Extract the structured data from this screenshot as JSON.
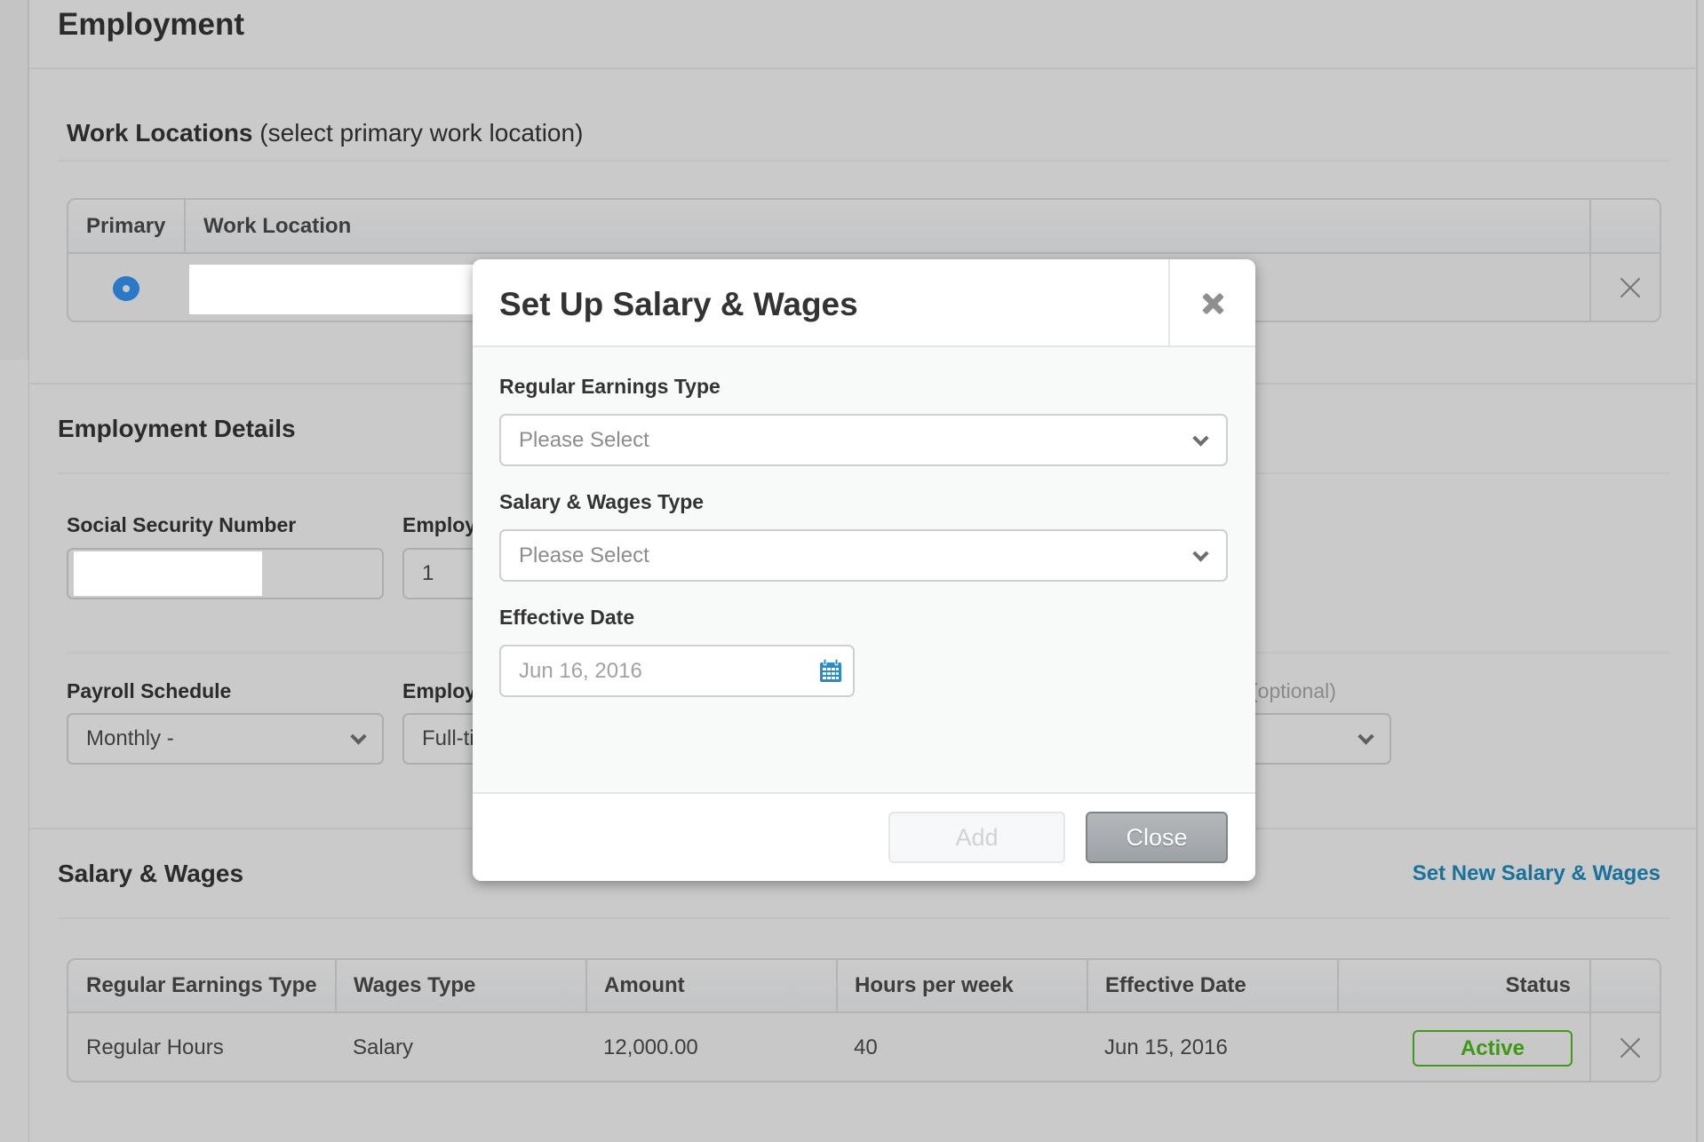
{
  "page": {
    "title": "Employment"
  },
  "work_locations": {
    "heading": "Work Locations",
    "subheading": "(select primary work location)",
    "columns": [
      "Primary",
      "Work Location"
    ],
    "rows": [
      {
        "primary": true,
        "location": ""
      }
    ]
  },
  "employment_details": {
    "heading": "Employment Details",
    "fields": {
      "ssn": {
        "label": "Social Security Number",
        "value": ""
      },
      "employee_id": {
        "label": "Employ",
        "value": "1"
      },
      "payroll_schedule": {
        "label": "Payroll Schedule",
        "value": "Monthly -"
      },
      "employment_type": {
        "label": "Employ",
        "value": "Full-ti"
      },
      "optional_field": {
        "label": "(optional)",
        "value": ""
      }
    }
  },
  "salary_wages": {
    "heading": "Salary & Wages",
    "set_new_link": "Set New Salary & Wages",
    "columns": [
      "Regular Earnings Type",
      "Wages Type",
      "Amount",
      "Hours per week",
      "Effective Date",
      "Status"
    ],
    "rows": [
      {
        "earnings_type": "Regular Hours",
        "wages_type": "Salary",
        "amount": "12,000.00",
        "hours_per_week": "40",
        "effective_date": "Jun 15, 2016",
        "status": "Active"
      }
    ]
  },
  "modal": {
    "title": "Set Up Salary & Wages",
    "regular_earnings_type": {
      "label": "Regular Earnings Type",
      "placeholder": "Please Select"
    },
    "salary_wages_type": {
      "label": "Salary & Wages Type",
      "placeholder": "Please Select"
    },
    "effective_date": {
      "label": "Effective Date",
      "placeholder": "Jun 16, 2016"
    },
    "buttons": {
      "add": "Add",
      "close": "Close"
    }
  },
  "colors": {
    "link": "#17729c",
    "active_status": "#3a9a12",
    "radio_selected": "#2a78c8",
    "calendar_icon": "#2a8cc4"
  }
}
